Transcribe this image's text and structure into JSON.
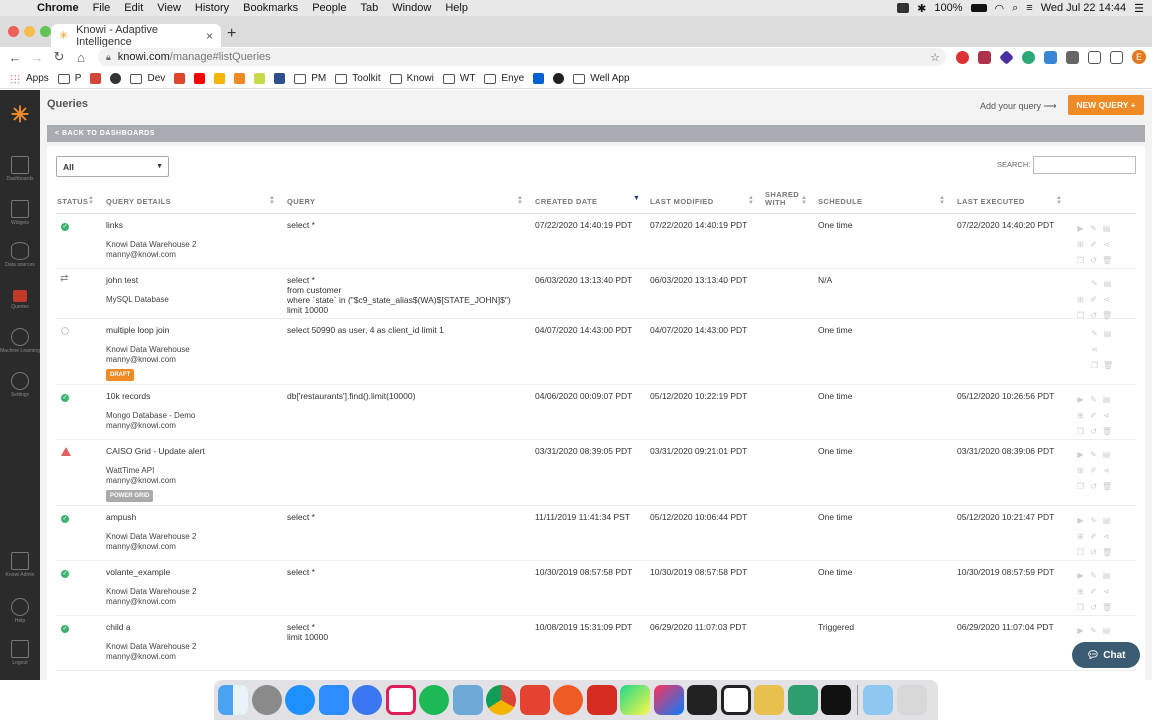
{
  "menubar": {
    "app": "Chrome",
    "items": [
      "File",
      "Edit",
      "View",
      "History",
      "Bookmarks",
      "People",
      "Tab",
      "Window",
      "Help"
    ],
    "battery": "100%",
    "datetime": "Wed Jul 22  14:44"
  },
  "tab": {
    "title": "Knowi - Adaptive Intelligence"
  },
  "address": {
    "host": "knowi.com",
    "path": "/manage#listQueries"
  },
  "bookmarks": [
    "Apps",
    "P",
    "Dev",
    "PM",
    "Toolkit",
    "Knowi",
    "WT",
    "Enye",
    "Well App"
  ],
  "sidebar": {
    "items": [
      {
        "label": "Dashboards"
      },
      {
        "label": "Widgets"
      },
      {
        "label": "Data sources"
      },
      {
        "label": "Queries"
      },
      {
        "label": "Machine Learning"
      },
      {
        "label": "Settings"
      },
      {
        "label": "Knowi Admin"
      },
      {
        "label": "Help"
      },
      {
        "label": "Logout"
      }
    ]
  },
  "page": {
    "title": "Queries",
    "add_hint": "Add your query",
    "new_query": "NEW QUERY +",
    "back": "< BACK TO DASHBOARDS",
    "filter_value": "All",
    "search_label": "SEARCH:"
  },
  "table": {
    "headers": {
      "status": "STATUS",
      "details": "QUERY DETAILS",
      "query": "QUERY",
      "created": "CREATED DATE",
      "modified": "LAST MODIFIED",
      "shared": "SHARED WITH",
      "schedule": "SCHEDULE",
      "last_exec": "LAST EXECUTED"
    },
    "rows": [
      {
        "status": "ok",
        "name": "links",
        "source": "Knowi Data Warehouse 2",
        "owner": "manny@knowi.com",
        "tag": "",
        "query": [
          "select *"
        ],
        "created": "07/22/2020 14:40:19 PDT",
        "modified": "07/22/2020 14:40:19 PDT",
        "schedule": "One time",
        "last_exec": "07/22/2020 14:40:20 PDT"
      },
      {
        "status": "sync",
        "name": "john test",
        "source": "MySQL Database",
        "owner": "",
        "tag": "",
        "query": [
          "select *",
          "from customer",
          "where `state` in (\"$c9_state_alias$(WA)$[STATE_JOHN]$\")",
          "limit 10000"
        ],
        "created": "06/03/2020 13:13:40 PDT",
        "modified": "06/03/2020 13:13:40 PDT",
        "schedule": "N/A",
        "last_exec": ""
      },
      {
        "status": "inactive",
        "name": "multiple loop join",
        "source": "Knowi Data Warehouse",
        "owner": "manny@knowi.com",
        "tag": "DRAFT",
        "query": [
          "select 50990 as user, 4 as client_id limit 1"
        ],
        "created": "04/07/2020 14:43:00 PDT",
        "modified": "04/07/2020 14:43:00 PDT",
        "schedule": "One time",
        "last_exec": ""
      },
      {
        "status": "ok",
        "name": "10k records",
        "source": "Mongo Database - Demo",
        "owner": "manny@knowi.com",
        "tag": "",
        "query": [
          "db['restaurants'].find().limit(10000)"
        ],
        "created": "04/06/2020 00:09:07 PDT",
        "modified": "05/12/2020 10:22:19 PDT",
        "schedule": "One time",
        "last_exec": "05/12/2020 10:26:56 PDT"
      },
      {
        "status": "alert",
        "name": "CAISO Grid - Update alert",
        "source": "WattTime API",
        "owner": "manny@knowi.com",
        "tag": "POWER GRID",
        "query": [],
        "created": "03/31/2020 08:39:05 PDT",
        "modified": "03/31/2020 09:21:01 PDT",
        "schedule": "One time",
        "last_exec": "03/31/2020 08:39:06 PDT"
      },
      {
        "status": "ok",
        "name": "ampush",
        "source": "Knowi Data Warehouse 2",
        "owner": "manny@knowi.com",
        "tag": "",
        "query": [
          "select *"
        ],
        "created": "11/11/2019 11:41:34 PST",
        "modified": "05/12/2020 10:06:44 PDT",
        "schedule": "One time",
        "last_exec": "05/12/2020 10:21:47 PDT"
      },
      {
        "status": "ok",
        "name": "volante_example",
        "source": "Knowi Data Warehouse 2",
        "owner": "manny@knowi.com",
        "tag": "",
        "query": [
          "select *"
        ],
        "created": "10/30/2019 08:57:58 PDT",
        "modified": "10/30/2019 08:57:58 PDT",
        "schedule": "One time",
        "last_exec": "10/30/2019 08:57:59 PDT"
      },
      {
        "status": "ok",
        "name": "child a",
        "source": "Knowi Data Warehouse 2",
        "owner": "manny@knowi.com",
        "tag": "",
        "query": [
          "select *",
          "limit 10000"
        ],
        "created": "10/08/2019 15:31:09 PDT",
        "modified": "06/29/2020 11:07:03 PDT",
        "schedule": "Triggered",
        "last_exec": "06/29/2020 11:07:04 PDT"
      }
    ]
  },
  "chat": {
    "label": "Chat"
  },
  "colors": {
    "accent": "#f08a24",
    "sidebar": "#2b2b2b",
    "ok": "#3cb371",
    "alert": "#e06060",
    "chat": "#3b5b72"
  }
}
